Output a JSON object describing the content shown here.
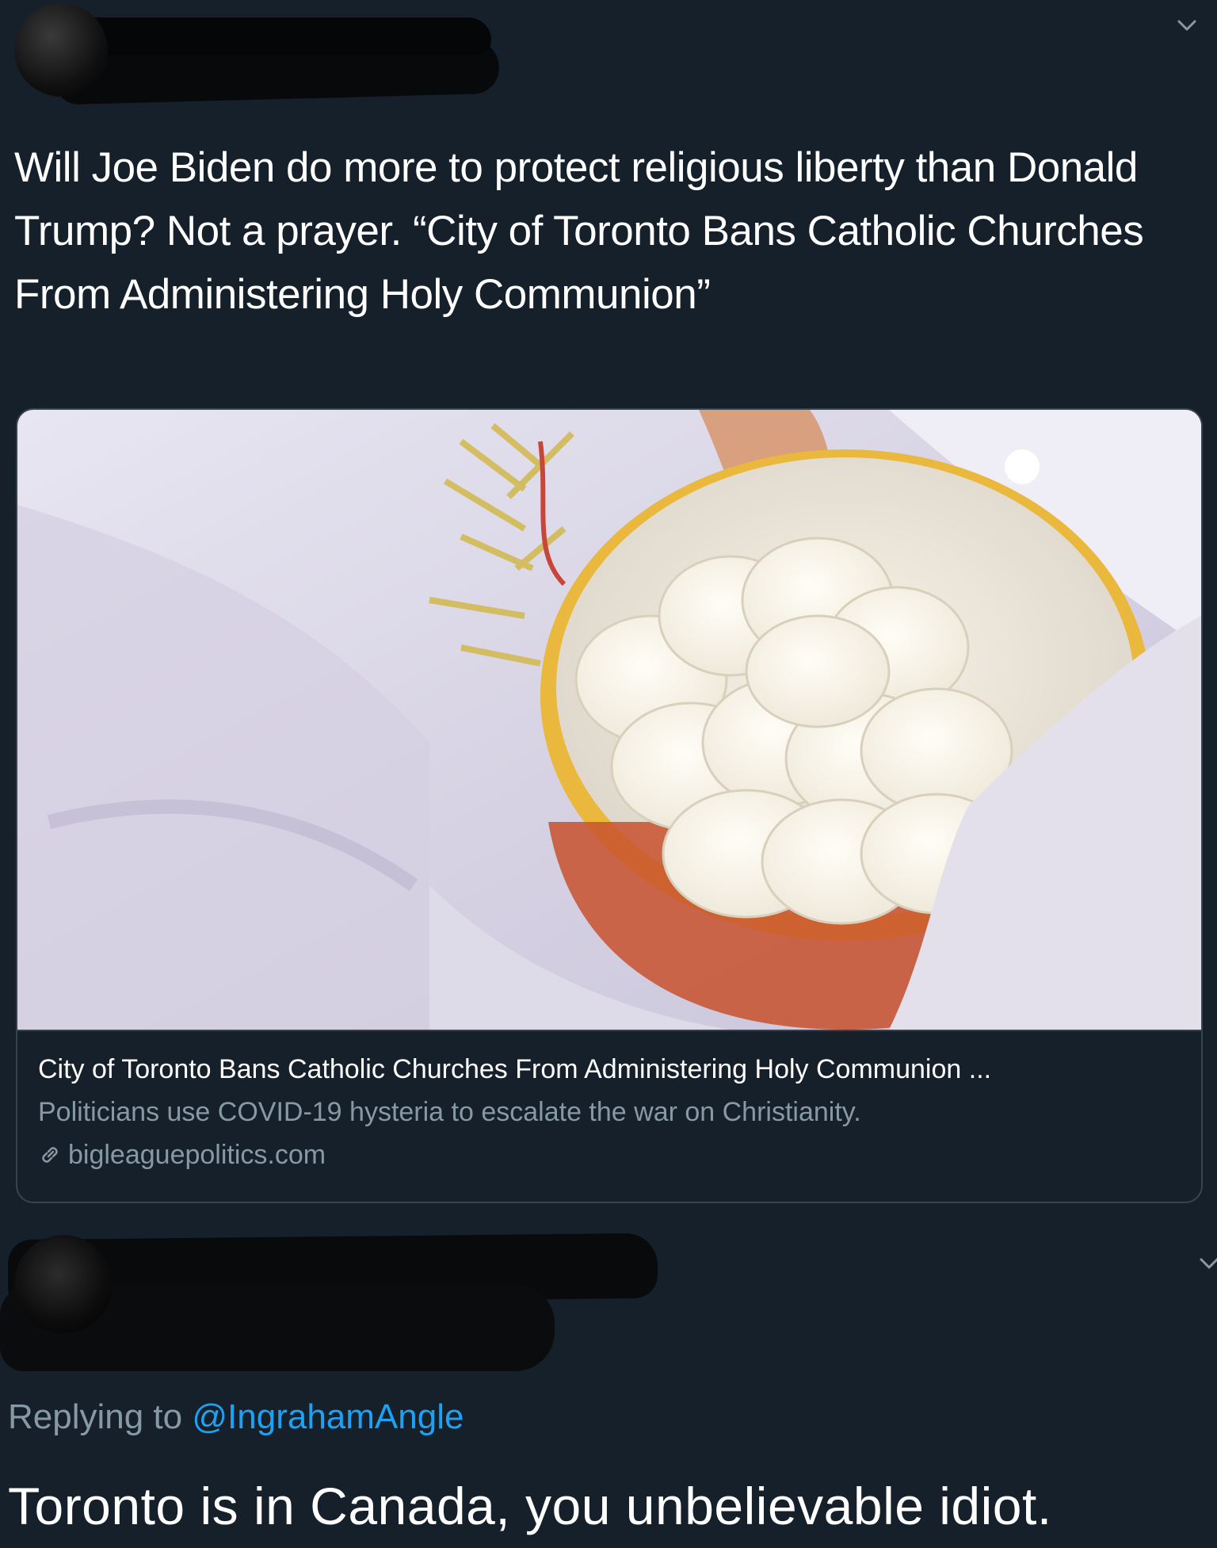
{
  "tweet": {
    "text": "Will Joe Biden do more to protect religious liberty than Donald Trump? Not a prayer. “City of Toronto Bans Catholic Churches From Administering Holy Communion”"
  },
  "link_card": {
    "image_icon": "communion-wafers-bowl-photo",
    "title": "City of Toronto Bans Catholic Churches From Administering Holy Communion ...",
    "description": "Politicians use COVID-19 hysteria to escalate the war on Christianity.",
    "domain_icon": "link-icon",
    "domain": "bigleaguepolitics.com"
  },
  "reply": {
    "replying_prefix": "Replying to",
    "replying_handle": "@IngrahamAngle",
    "text": "Toronto is in Canada, you unbelievable idiot."
  },
  "icons": {
    "menu": "chevron-down-icon"
  },
  "colors": {
    "background": "#15202b",
    "text": "#ffffff",
    "secondary_text": "#8899a6",
    "link": "#1da1f2",
    "border": "#38444d"
  }
}
